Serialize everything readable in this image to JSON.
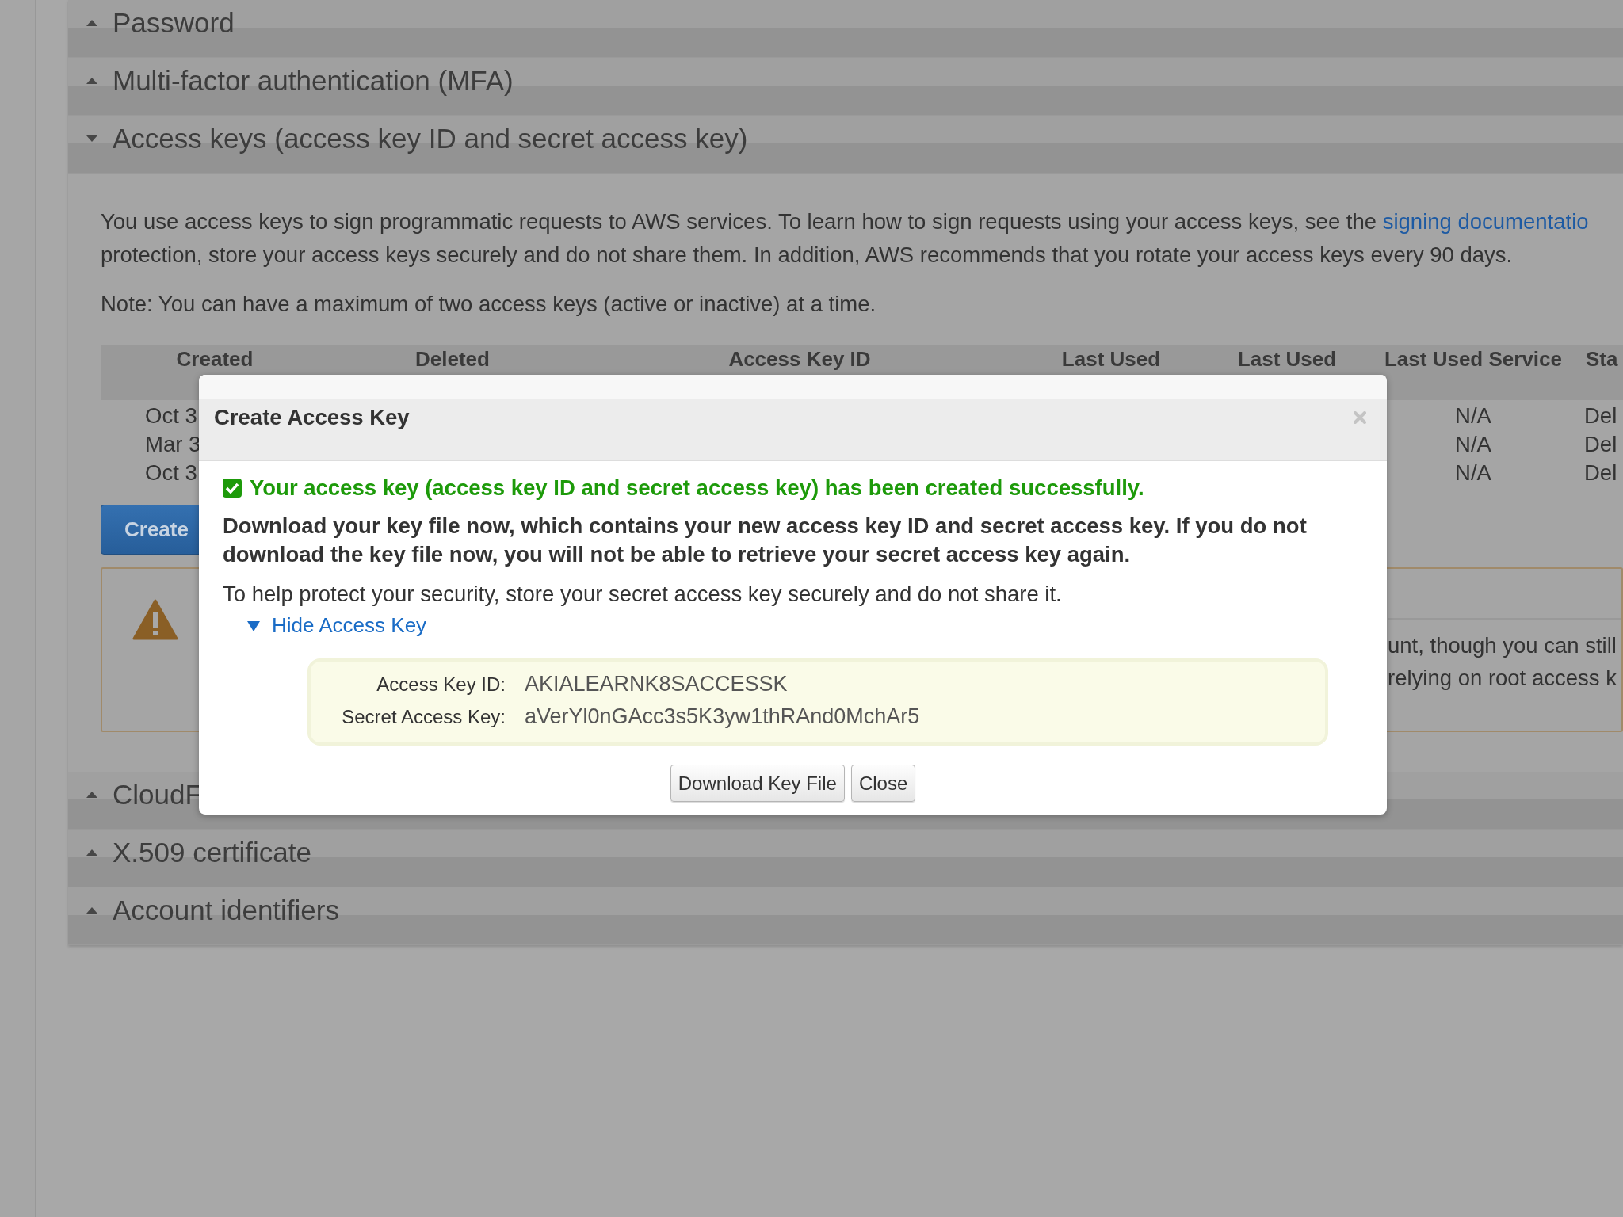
{
  "sections": [
    {
      "title": "Password",
      "expanded": false
    },
    {
      "title": "Multi-factor authentication (MFA)",
      "expanded": false
    },
    {
      "title": "Access keys (access key ID and secret access key)",
      "expanded": true
    },
    {
      "title": "CloudF",
      "expanded": false
    },
    {
      "title": "X.509 certificate",
      "expanded": false
    },
    {
      "title": "Account identifiers",
      "expanded": false
    }
  ],
  "access_keys": {
    "intro_line_1": "You use access keys to sign programmatic requests to AWS services. To learn how to sign requests using your access keys, see the",
    "intro_link": "signing documentatio",
    "intro_line_2": "protection, store your access keys securely and do not share them. In addition, AWS recommends that you rotate your access keys every 90 days.",
    "note": "Note: You can have a maximum of two access keys (active or inactive) at a time.",
    "table": {
      "columns": [
        "Created",
        "Deleted",
        "Access Key ID",
        "Last Used",
        "Last Used",
        "Last Used Service",
        "Sta"
      ],
      "rows": [
        {
          "created": "Oct 3",
          "last_used_service": "N/A",
          "status": "Del"
        },
        {
          "created": "Mar 3",
          "last_used_service": "N/A",
          "status": "Del"
        },
        {
          "created": "Oct 3",
          "last_used_service": "N/A",
          "status": "Del"
        }
      ]
    },
    "create_button": "Create",
    "warning_lines": [
      "unt, though you can still",
      "relying on root access k"
    ]
  },
  "modal": {
    "title": "Create Access Key",
    "success": "Your access key (access key ID and secret access key) has been created successfully.",
    "download_notice": "Download your key file now, which contains your new access key ID and secret access key. If you do not download the key file now, you will not be able to retrieve your secret access key again.",
    "security_note": "To help protect your security, store your secret access key securely and do not share it.",
    "toggle": {
      "label": "Hide Access Key",
      "expanded": true
    },
    "fields": [
      {
        "label": "Access Key ID:",
        "value": "AKIALEARNK8SACCESSK"
      },
      {
        "label": "Secret Access Key:",
        "value": "aVerYl0nGAcc3s5K3yw1thRAnd0MchAr5"
      }
    ],
    "buttons": [
      "Download Key File",
      "Close"
    ]
  }
}
